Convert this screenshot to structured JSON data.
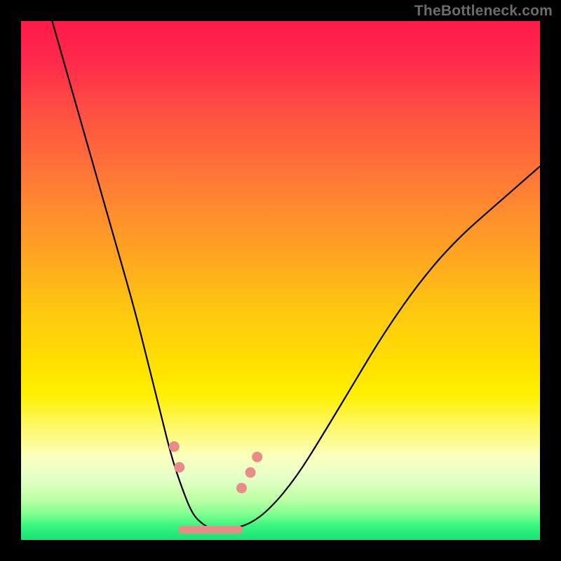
{
  "watermark": "TheBottleneck.com",
  "colors": {
    "frame": "#000000",
    "gradient_top": "#ff1a4a",
    "gradient_mid": "#ffe000",
    "gradient_bottom": "#1ee076",
    "curve": "#000000",
    "marker": "#e98b88"
  },
  "chart_data": {
    "type": "line",
    "title": "",
    "xlabel": "",
    "ylabel": "",
    "xlim": [
      0,
      100
    ],
    "ylim": [
      0,
      100
    ],
    "grid": false,
    "series": [
      {
        "name": "bottleneck-curve",
        "x": [
          6,
          10,
          14,
          18,
          22,
          25,
          27,
          29,
          31,
          33,
          35,
          37,
          40,
          44,
          48,
          53,
          58,
          64,
          70,
          77,
          84,
          92,
          100
        ],
        "y": [
          100,
          86,
          72,
          58,
          44,
          32,
          24,
          16,
          10,
          5,
          3,
          2,
          2,
          3,
          6,
          12,
          20,
          30,
          40,
          50,
          58,
          65,
          72
        ]
      }
    ],
    "markers": [
      {
        "x": 29.5,
        "y": 18
      },
      {
        "x": 30.5,
        "y": 14
      },
      {
        "x": 42.5,
        "y": 10
      },
      {
        "x": 44.2,
        "y": 13
      },
      {
        "x": 45.5,
        "y": 16
      }
    ],
    "marker_floor_segment": {
      "x_start": 31,
      "x_end": 42,
      "y": 2
    },
    "note": "x and y are percentages of the plot area from left/bottom; curve is a V shape with minimum near x≈36, y≈2."
  }
}
